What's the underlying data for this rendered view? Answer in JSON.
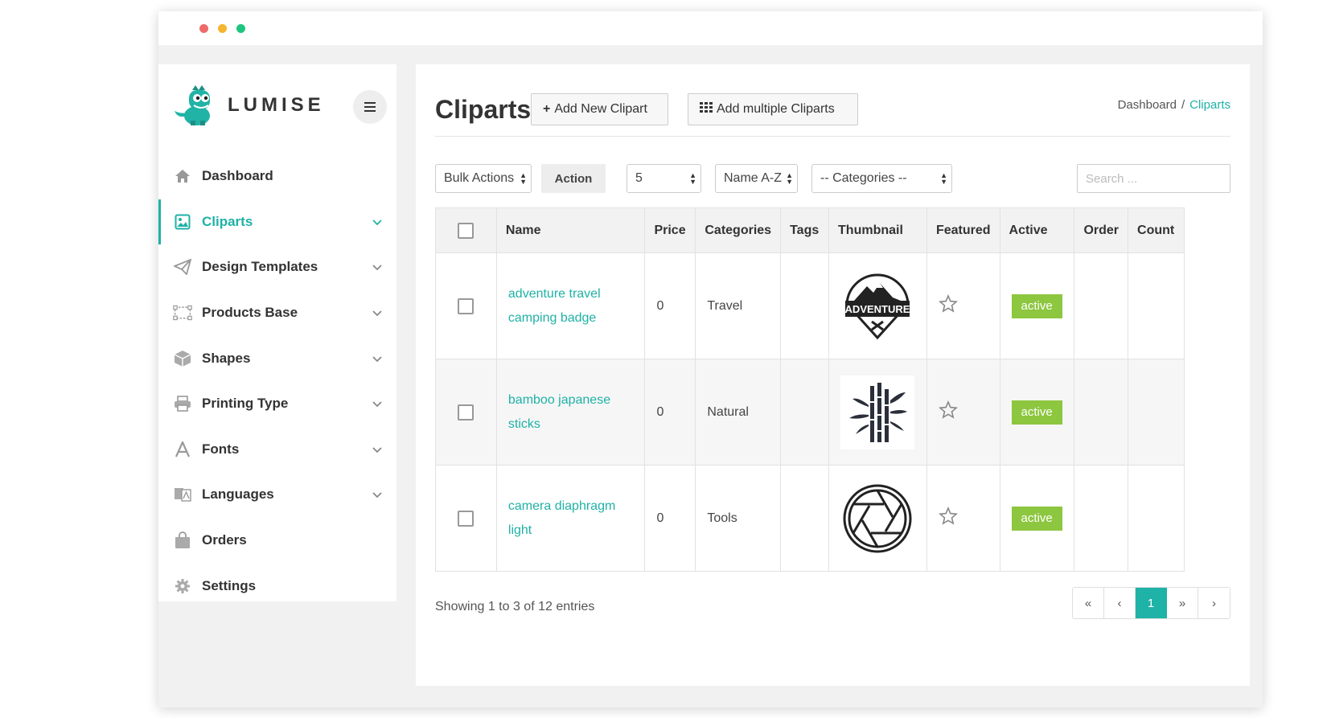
{
  "colors": {
    "accent": "#1fb2a6",
    "active_badge": "#8dc63f"
  },
  "brand": {
    "name": "LUMISE"
  },
  "sidebar": {
    "items": [
      {
        "label": "Dashboard",
        "icon": "home-icon"
      },
      {
        "label": "Cliparts",
        "icon": "image-icon",
        "active": true
      },
      {
        "label": "Design Templates",
        "icon": "paper-plane-icon"
      },
      {
        "label": "Products Base",
        "icon": "object-group-icon"
      },
      {
        "label": "Shapes",
        "icon": "cube-icon"
      },
      {
        "label": "Printing Type",
        "icon": "printer-icon"
      },
      {
        "label": "Fonts",
        "icon": "font-icon"
      },
      {
        "label": "Languages",
        "icon": "language-icon"
      },
      {
        "label": "Orders",
        "icon": "shopping-bag-icon"
      },
      {
        "label": "Settings",
        "icon": "gear-icon"
      }
    ]
  },
  "header": {
    "title": "Cliparts",
    "add_new_label": "Add New Clipart",
    "add_multiple_label": "Add multiple Cliparts",
    "breadcrumb": {
      "parent": "Dashboard",
      "separator": "/",
      "current": "Cliparts"
    }
  },
  "toolbar": {
    "bulk_actions": "Bulk Actions",
    "action_label": "Action",
    "per_page": "5",
    "sort": "Name A-Z",
    "categories": "-- Categories --",
    "search_placeholder": "Search ..."
  },
  "table": {
    "columns": [
      "Name",
      "Price",
      "Categories",
      "Tags",
      "Thumbnail",
      "Featured",
      "Active",
      "Order",
      "Count"
    ],
    "rows": [
      {
        "name": "adventure travel camping badge",
        "price": "0",
        "category": "Travel",
        "tags": "",
        "thumbnail": "adventure-badge-thumbnail",
        "active": "active",
        "order": "",
        "count": ""
      },
      {
        "name": "bamboo japanese sticks",
        "price": "0",
        "category": "Natural",
        "tags": "",
        "thumbnail": "bamboo-thumbnail",
        "active": "active",
        "order": "",
        "count": ""
      },
      {
        "name": "camera diaphragm light",
        "price": "0",
        "category": "Tools",
        "tags": "",
        "thumbnail": "camera-aperture-thumbnail",
        "active": "active",
        "order": "",
        "count": ""
      }
    ],
    "thumbnail_texts": {
      "adventure": "ADVENTURE"
    }
  },
  "footer": {
    "showing": "Showing 1 to 3 of 12 entries",
    "pager": {
      "first": "«",
      "prev": "‹",
      "current": "1",
      "next": "»",
      "last": "›"
    }
  }
}
